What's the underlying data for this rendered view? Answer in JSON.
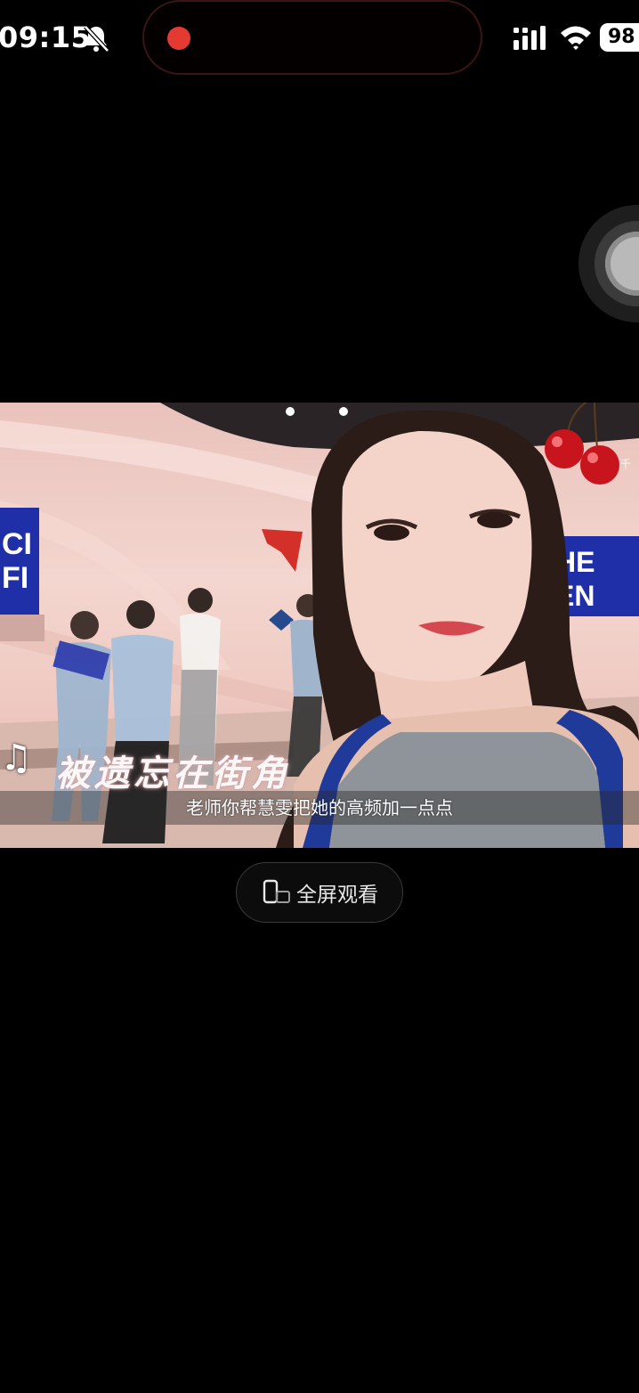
{
  "status_bar": {
    "time": "09:15",
    "battery": "98",
    "mute_icon": "bell-slash-icon",
    "signal_icon": "cellular-signal-icon",
    "wifi_icon": "wifi-icon",
    "recording_indicator_color": "#e53a31"
  },
  "video": {
    "lyric_overlay": "被遗忘在街角",
    "subtitle": "老师你帮慧雯把她的高频加一点点",
    "watermark": "千",
    "sticker": "cherry-sticker-icon",
    "music_note_icon": "music-note-icon"
  },
  "controls": {
    "fullscreen_label": "全屏观看",
    "fullscreen_icon": "rotate-phone-icon"
  },
  "assistive_touch": {
    "icon": "assistive-touch-icon"
  },
  "colors": {
    "background": "#000000",
    "recording": "#e53a31",
    "video_wall": "#f3d6cf",
    "screen_blue": "#1f2fa8"
  }
}
